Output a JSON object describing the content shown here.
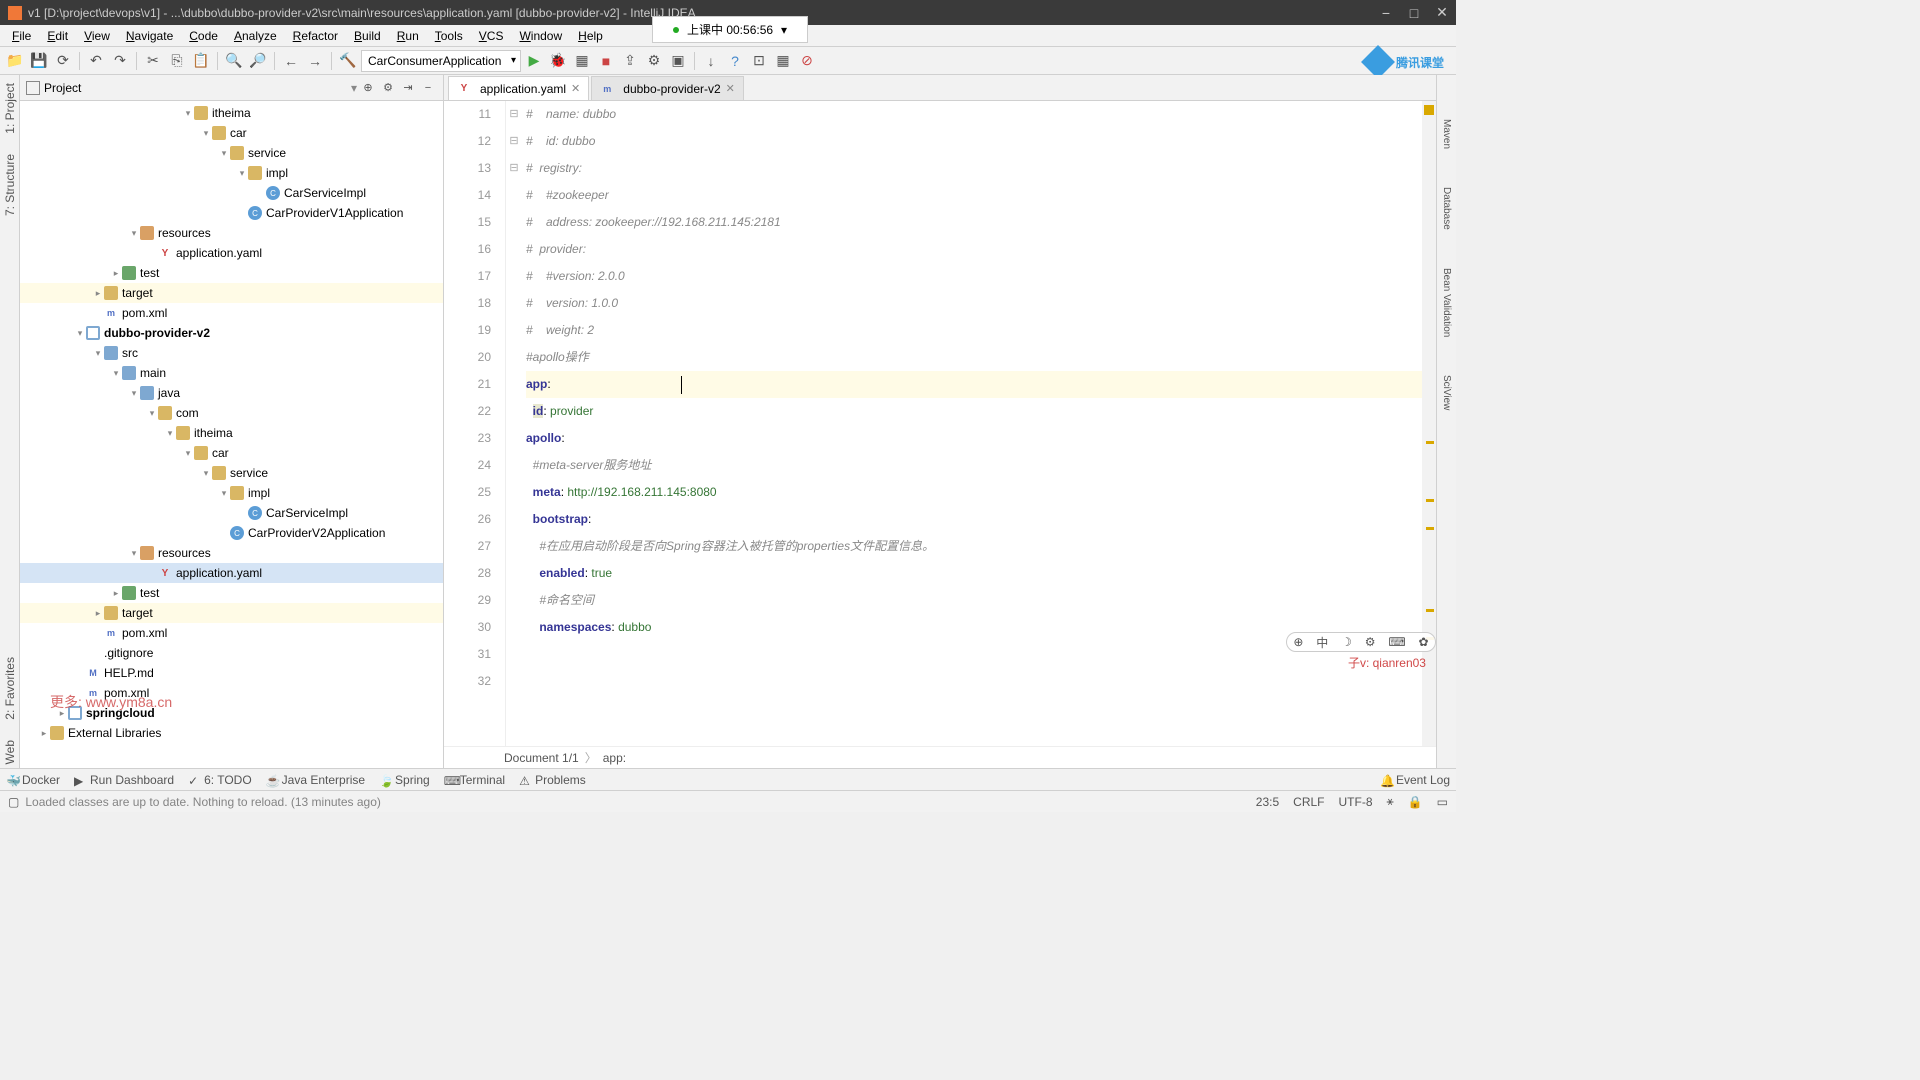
{
  "window": {
    "title": "v1 [D:\\project\\devops\\v1] - ...\\dubbo\\dubbo-provider-v2\\src\\main\\resources\\application.yaml [dubbo-provider-v2] - IntelliJ IDEA",
    "class_badge": "上课中 00:56:56"
  },
  "menus": [
    "File",
    "Edit",
    "View",
    "Navigate",
    "Code",
    "Analyze",
    "Refactor",
    "Build",
    "Run",
    "Tools",
    "VCS",
    "Window",
    "Help"
  ],
  "run_config": "CarConsumerApplication",
  "logo_text": "腾讯课堂",
  "project": {
    "title": "Project",
    "watermark": "更多: www.ym8a.cn",
    "rows": [
      {
        "indent": 9,
        "arrow": "▾",
        "icon": "folder",
        "label": "itheima"
      },
      {
        "indent": 10,
        "arrow": "▾",
        "icon": "folder",
        "label": "car"
      },
      {
        "indent": 11,
        "arrow": "▾",
        "icon": "folder",
        "label": "service"
      },
      {
        "indent": 12,
        "arrow": "▾",
        "icon": "folder",
        "label": "impl"
      },
      {
        "indent": 13,
        "arrow": "",
        "icon": "class",
        "label": "CarServiceImpl"
      },
      {
        "indent": 12,
        "arrow": "",
        "icon": "class",
        "label": "CarProviderV1Application"
      },
      {
        "indent": 6,
        "arrow": "▾",
        "icon": "folder-res",
        "label": "resources"
      },
      {
        "indent": 7,
        "arrow": "",
        "icon": "yaml",
        "label": "application.yaml"
      },
      {
        "indent": 5,
        "arrow": "▸",
        "icon": "folder-test",
        "label": "test"
      },
      {
        "indent": 4,
        "arrow": "▸",
        "icon": "folder",
        "label": "target",
        "hl": true
      },
      {
        "indent": 4,
        "arrow": "",
        "icon": "xml",
        "label": "pom.xml"
      },
      {
        "indent": 3,
        "arrow": "▾",
        "icon": "module",
        "label": "dubbo-provider-v2",
        "bold": true
      },
      {
        "indent": 4,
        "arrow": "▾",
        "icon": "folder-src",
        "label": "src"
      },
      {
        "indent": 5,
        "arrow": "▾",
        "icon": "folder-src",
        "label": "main"
      },
      {
        "indent": 6,
        "arrow": "▾",
        "icon": "folder-src",
        "label": "java"
      },
      {
        "indent": 7,
        "arrow": "▾",
        "icon": "folder",
        "label": "com"
      },
      {
        "indent": 8,
        "arrow": "▾",
        "icon": "folder",
        "label": "itheima"
      },
      {
        "indent": 9,
        "arrow": "▾",
        "icon": "folder",
        "label": "car"
      },
      {
        "indent": 10,
        "arrow": "▾",
        "icon": "folder",
        "label": "service"
      },
      {
        "indent": 11,
        "arrow": "▾",
        "icon": "folder",
        "label": "impl"
      },
      {
        "indent": 12,
        "arrow": "",
        "icon": "class",
        "label": "CarServiceImpl"
      },
      {
        "indent": 11,
        "arrow": "",
        "icon": "class",
        "label": "CarProviderV2Application"
      },
      {
        "indent": 6,
        "arrow": "▾",
        "icon": "folder-res",
        "label": "resources"
      },
      {
        "indent": 7,
        "arrow": "",
        "icon": "yaml",
        "label": "application.yaml",
        "selected": true
      },
      {
        "indent": 5,
        "arrow": "▸",
        "icon": "folder-test",
        "label": "test"
      },
      {
        "indent": 4,
        "arrow": "▸",
        "icon": "folder",
        "label": "target",
        "hl": true
      },
      {
        "indent": 4,
        "arrow": "",
        "icon": "xml",
        "label": "pom.xml"
      },
      {
        "indent": 3,
        "arrow": "",
        "icon": "git",
        "label": ".gitignore"
      },
      {
        "indent": 3,
        "arrow": "",
        "icon": "md",
        "label": "HELP.md"
      },
      {
        "indent": 3,
        "arrow": "",
        "icon": "xml",
        "label": "pom.xml"
      },
      {
        "indent": 2,
        "arrow": "▸",
        "icon": "module",
        "label": "springcloud",
        "bold": true
      },
      {
        "indent": 1,
        "arrow": "▸",
        "icon": "lib",
        "label": "External Libraries"
      }
    ]
  },
  "tabs": [
    {
      "icon": "yaml",
      "label": "application.yaml",
      "active": true
    },
    {
      "icon": "xml",
      "label": "dubbo-provider-v2",
      "active": false
    }
  ],
  "editor_lines": [
    {
      "n": 11,
      "html": "<span class='comment'>#    name: dubbo</span>"
    },
    {
      "n": 12,
      "html": "<span class='comment'>#    id: dubbo</span>"
    },
    {
      "n": 13,
      "html": "<span class='comment'>#  registry:</span>"
    },
    {
      "n": 14,
      "html": "<span class='comment'>#    #zookeeper</span>"
    },
    {
      "n": 15,
      "html": "<span class='comment'>#    address: zookeeper://192.168.211.145:2181</span>"
    },
    {
      "n": 16,
      "html": "<span class='comment'>#  provider:</span>"
    },
    {
      "n": 17,
      "html": "<span class='comment'>#    #version: 2.0.0</span>"
    },
    {
      "n": 18,
      "html": "<span class='comment'>#    version: 1.0.0</span>"
    },
    {
      "n": 19,
      "html": "<span class='comment'>#    weight: 2</span>"
    },
    {
      "n": 20,
      "html": ""
    },
    {
      "n": 21,
      "html": ""
    },
    {
      "n": 22,
      "html": "<span class='comment'>#apollo操作</span>"
    },
    {
      "n": 23,
      "html": "<span class='key'>app</span>:",
      "current": true,
      "cursor": true
    },
    {
      "n": 24,
      "html": "  <span class='key hl-id'>id</span>: <span class='str'>provider</span>"
    },
    {
      "n": 25,
      "html": "<span class='key'>apollo</span>:"
    },
    {
      "n": 26,
      "html": "  <span class='comment'>#meta-server服务地址</span>"
    },
    {
      "n": 27,
      "html": "  <span class='key'>meta</span>: <span class='str'>http://192.168.211.145:8080</span>"
    },
    {
      "n": 28,
      "html": "  <span class='key'>bootstrap</span>:"
    },
    {
      "n": 29,
      "html": "    <span class='comment'>#在应用启动阶段是否向Spring容器注入被托管的properties文件配置信息。</span>"
    },
    {
      "n": 30,
      "html": "    <span class='key'>enabled</span>: <span class='str'>true</span>"
    },
    {
      "n": 31,
      "html": "    <span class='comment'>#命名空间</span>"
    },
    {
      "n": 32,
      "html": "    <span class='key'>namespaces</span>: <span class='str'>dubbo</span>"
    }
  ],
  "breadcrumb": [
    "Document 1/1",
    "app:"
  ],
  "bottom_tabs": [
    "Docker",
    "Run Dashboard",
    "6: TODO",
    "Java Enterprise",
    "Spring",
    "Terminal",
    "Problems"
  ],
  "event_log": "Event Log",
  "status": {
    "msg": "Loaded classes are up to date. Nothing to reload. (13 minutes ago)",
    "pos": "23:5",
    "sep": "CRLF",
    "enc": "UTF-8"
  },
  "overlay_text": "子v: qianren03",
  "left_tabs": [
    "1: Project",
    "7: Structure"
  ],
  "left_tabs_bottom": [
    "2: Favorites",
    "Web"
  ],
  "right_tabs": [
    "Maven",
    "Database",
    "Bean Validation",
    "SciView"
  ]
}
